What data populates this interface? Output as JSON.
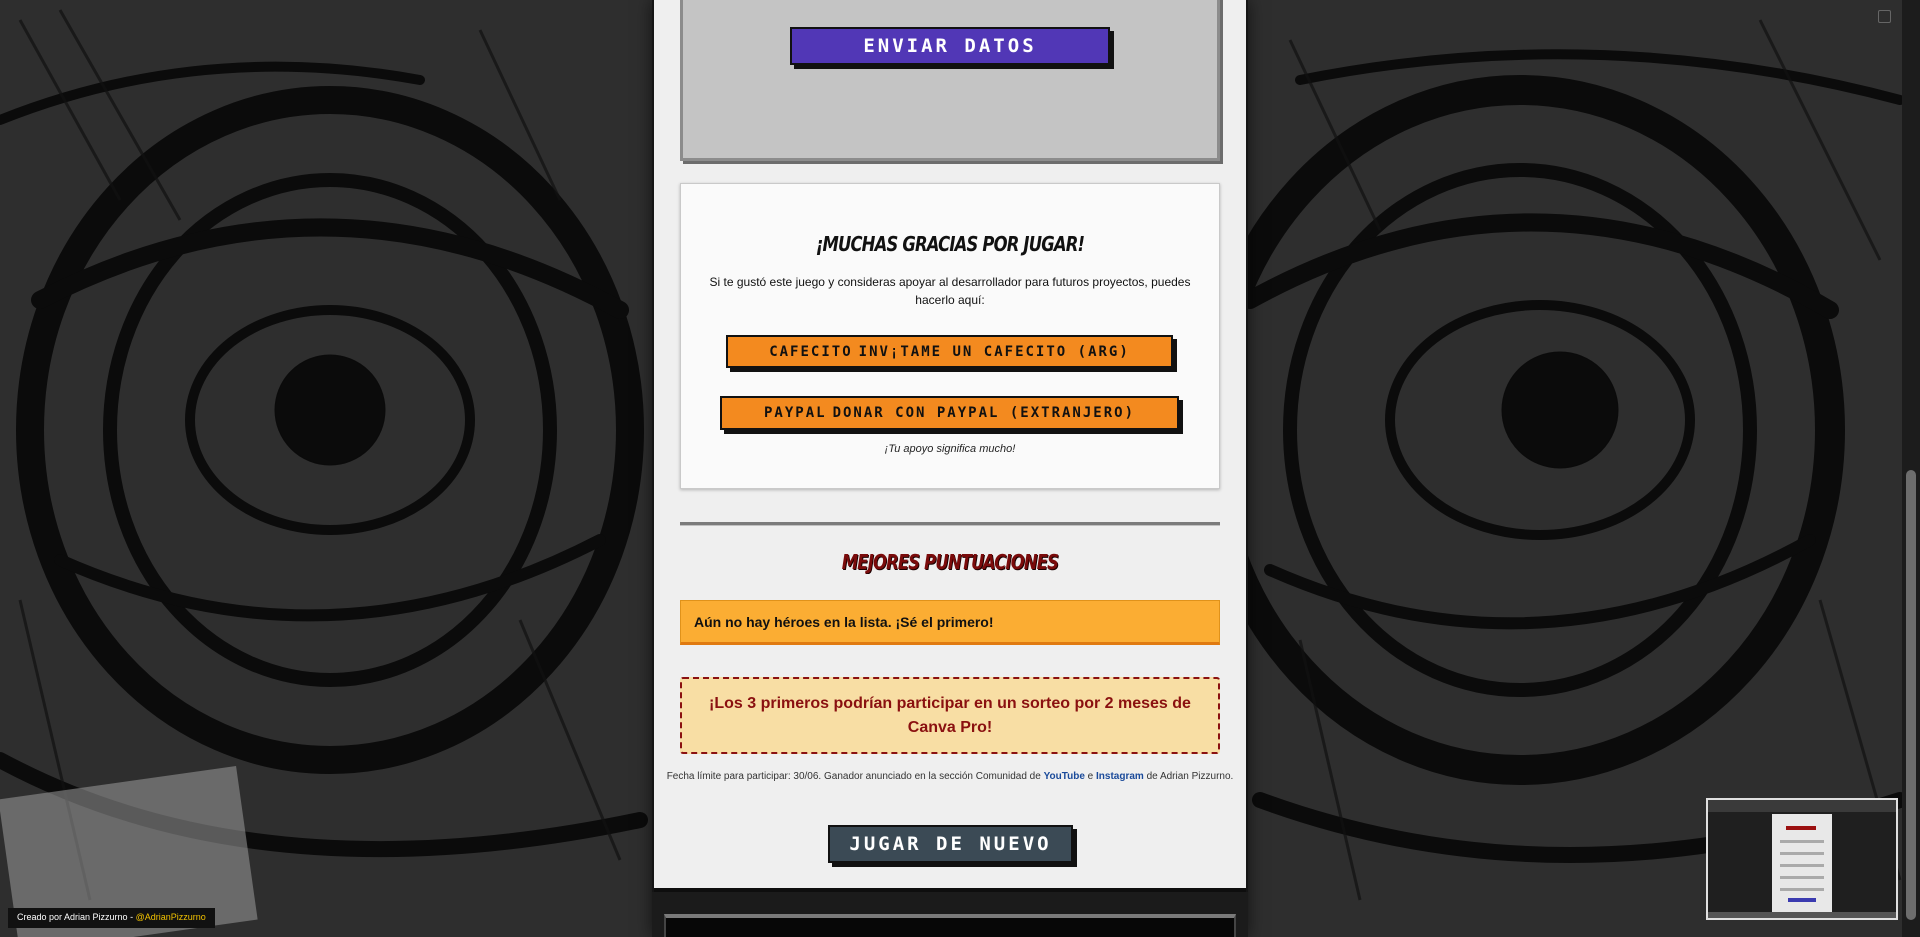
{
  "form": {
    "send_label": "ENVIAR DATOS"
  },
  "support": {
    "title": "¡MUCHAS GRACIAS POR JUGAR!",
    "text": "Si te gustó este juego y consideras apoyar al desarrollador para futuros proyectos, puedes hacerlo aquí:",
    "cafecito_alt": "CAFECITO",
    "cafecito_label": "INV¡TAME UN CAFECITO (ARG)",
    "paypal_alt": "PAYPAL",
    "paypal_label": "DONAR CON PAYPAL (EXTRANJERO)",
    "note": "¡Tu apoyo significa mucho!"
  },
  "scores": {
    "title": "MEJORES PUNTUACIONES",
    "empty_message": "Aún no hay héroes en la lista. ¡Sé el primero!",
    "raffle": "¡Los 3 primeros podrían participar en un sorteo por 2 meses de Canva Pro!",
    "deadline_prefix": "Fecha límite para participar: 30/06. Ganador anunciado en la sección Comunidad de",
    "youtube": "YouTube",
    "and": "e",
    "instagram": "Instagram",
    "deadline_suffix": "de Adrian Pizzurno."
  },
  "replay_label": "JUGAR DE NUEVO",
  "credits": {
    "text": "Creado por Adrian Pizzurno -",
    "handle": "@AdrianPizzurno"
  },
  "colors": {
    "send_button": "#5137b6",
    "donate_button": "#f38a1f",
    "scores_title": "#7a0b0b",
    "empty_list_bg": "#fbad33",
    "raffle_bg": "#f8dea4",
    "raffle_text": "#8a1010",
    "replay_button": "#3b4a55",
    "link": "#1a4a9a",
    "handle": "#f2c200"
  }
}
